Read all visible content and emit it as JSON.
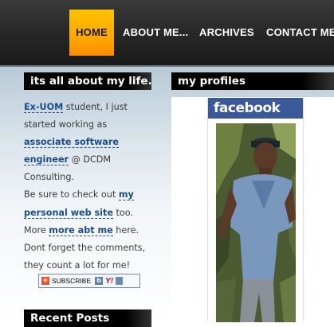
{
  "nav": {
    "items": [
      {
        "label": "HOME",
        "active": true
      },
      {
        "label": "ABOUT ME..."
      },
      {
        "label": "ARCHIVES"
      },
      {
        "label": "CONTACT ME"
      }
    ]
  },
  "sidebar": {
    "about_heading": "its all about my life...",
    "about": {
      "link_exuom": "Ex-UOM",
      "t1": " student, I just started working as ",
      "link_job": "associate software engineer",
      "t2": " @ DCDM Consulting.",
      "t3": "Be sure to check out ",
      "link_site": "my personal web site",
      "t4": " too.",
      "t5": "More ",
      "link_more": "more abt me",
      "t6": " here.",
      "t7": "Dont forget the comments, they count a lot for me!"
    },
    "subscribe_label": "SUBSCRIBE",
    "subscribe_yahoo": "Y!",
    "recent_heading": "Recent Posts"
  },
  "profiles": {
    "heading": "my profiles",
    "facebook_label": "facebook"
  },
  "colors": {
    "nav_active": "#ffa800",
    "facebook_blue": "#3b5998",
    "link": "#1d4c86"
  }
}
